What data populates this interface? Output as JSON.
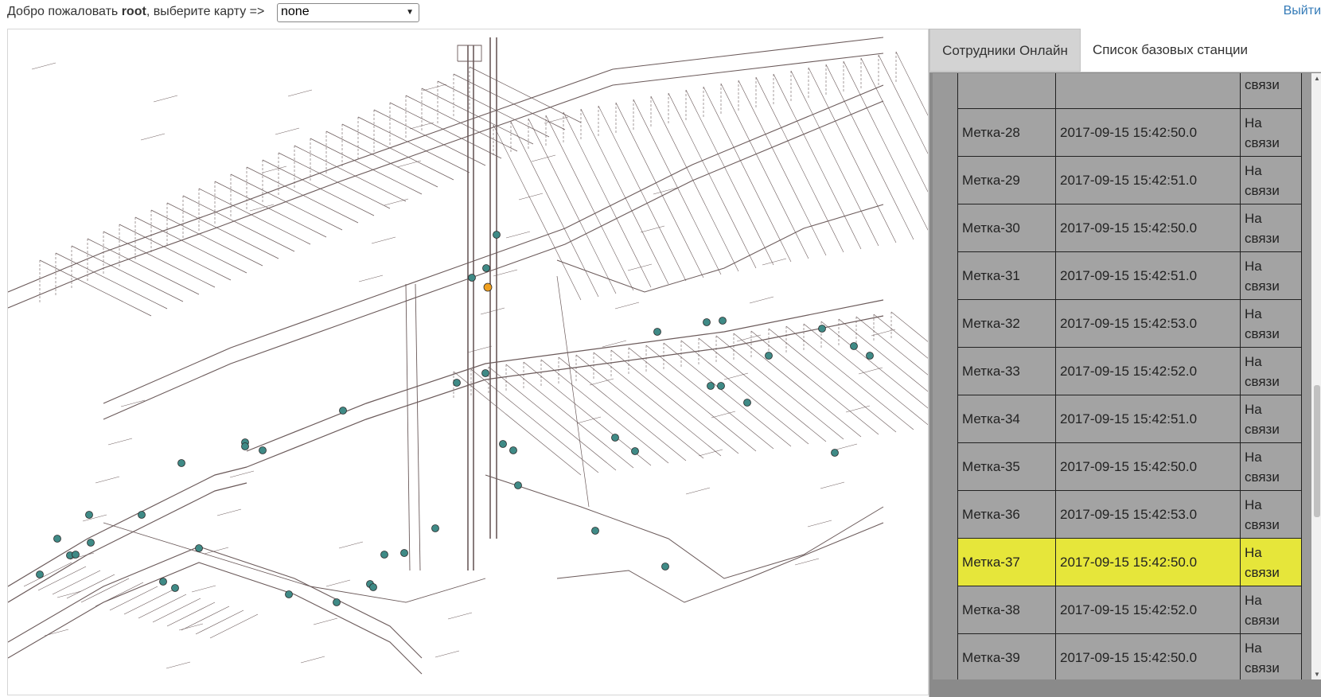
{
  "header": {
    "welcome_prefix": "Добро пожаловать ",
    "username": "root",
    "welcome_suffix": ", выберите карту =>",
    "map_select_value": "none",
    "logout_label": "Выйти"
  },
  "tabs": [
    {
      "label": "Сотрудники Онлайн",
      "active": true
    },
    {
      "label": "Список базовых станции",
      "active": false
    }
  ],
  "tags": [
    {
      "name": "",
      "time": "",
      "status": "связи",
      "highlight": false
    },
    {
      "name": "Метка-28",
      "time": "2017-09-15 15:42:50.0",
      "status": "На связи",
      "highlight": false
    },
    {
      "name": "Метка-29",
      "time": "2017-09-15 15:42:51.0",
      "status": "На связи",
      "highlight": false
    },
    {
      "name": "Метка-30",
      "time": "2017-09-15 15:42:50.0",
      "status": "На связи",
      "highlight": false
    },
    {
      "name": "Метка-31",
      "time": "2017-09-15 15:42:51.0",
      "status": "На связи",
      "highlight": false
    },
    {
      "name": "Метка-32",
      "time": "2017-09-15 15:42:53.0",
      "status": "На связи",
      "highlight": false
    },
    {
      "name": "Метка-33",
      "time": "2017-09-15 15:42:52.0",
      "status": "На связи",
      "highlight": false
    },
    {
      "name": "Метка-34",
      "time": "2017-09-15 15:42:51.0",
      "status": "На связи",
      "highlight": false
    },
    {
      "name": "Метка-35",
      "time": "2017-09-15 15:42:50.0",
      "status": "На связи",
      "highlight": false
    },
    {
      "name": "Метка-36",
      "time": "2017-09-15 15:42:53.0",
      "status": "На связи",
      "highlight": false
    },
    {
      "name": "Метка-37",
      "time": "2017-09-15 15:42:50.0",
      "status": "На связи",
      "highlight": true
    },
    {
      "name": "Метка-38",
      "time": "2017-09-15 15:42:52.0",
      "status": "На связи",
      "highlight": false
    },
    {
      "name": "Метка-39",
      "time": "2017-09-15 15:42:50.0",
      "status": "На связи",
      "highlight": false
    }
  ],
  "colors": {
    "marker_fill": "#3f8a86",
    "selected_marker_fill": "#f0a020",
    "highlight_row": "#e6e63a",
    "line_color": "#6b5a5a",
    "link": "#337ab7"
  },
  "map": {
    "markers_count_label": ""
  }
}
